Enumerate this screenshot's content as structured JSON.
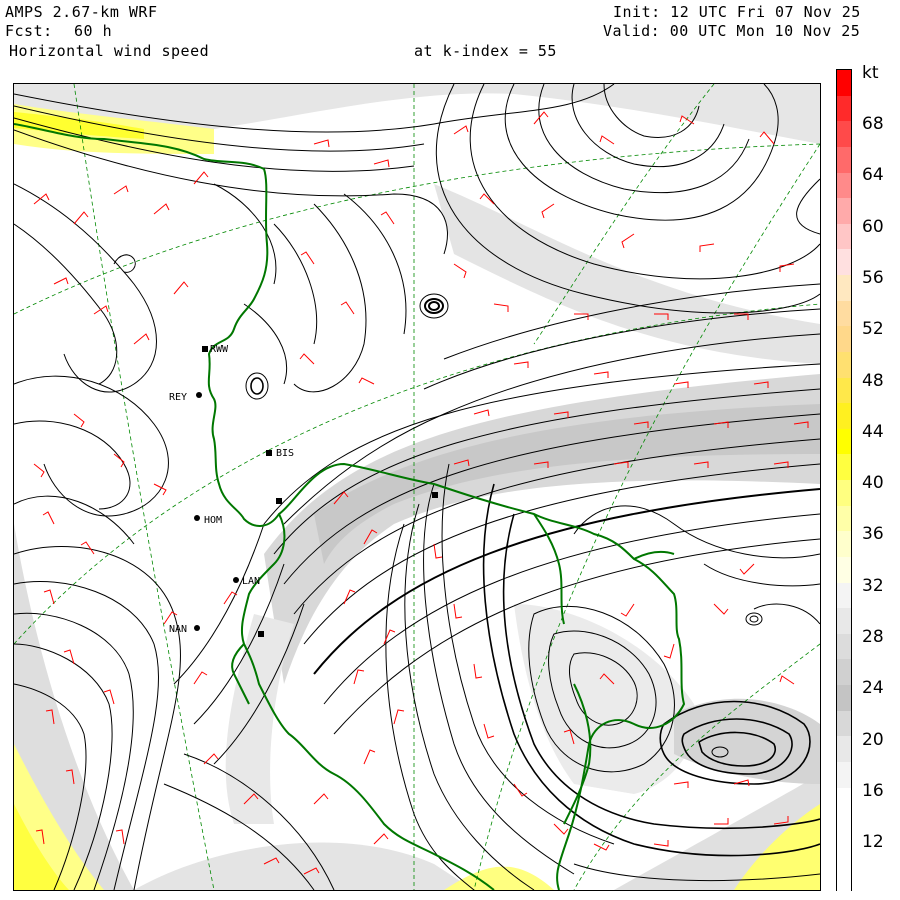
{
  "header": {
    "model": "AMPS 2.67-km WRF",
    "forecast_label": "Fcst:",
    "forecast_hours": "60 h",
    "field": "Horizontal wind speed",
    "init": "Init: 12 UTC Fri 07 Nov 25",
    "valid": "Valid: 00 UTC Mon 10 Nov 25",
    "level": "at k-index = 55"
  },
  "legend": {
    "unit": "kt",
    "labels": [
      "68",
      "64",
      "60",
      "56",
      "52",
      "48",
      "44",
      "40",
      "36",
      "32",
      "28",
      "24",
      "20",
      "16",
      "12"
    ],
    "bins": [
      {
        "color": "#ff0000"
      },
      {
        "color": "#ff2a2a"
      },
      {
        "color": "#ff4a4a"
      },
      {
        "color": "#ff6a6a"
      },
      {
        "color": "#ff8a8a"
      },
      {
        "color": "#ffaaaa"
      },
      {
        "color": "#ffc6c6"
      },
      {
        "color": "#ffe0e0"
      },
      {
        "color": "#ffe8c0"
      },
      {
        "color": "#ffdca0"
      },
      {
        "color": "#ffd88a"
      },
      {
        "color": "#ffe070"
      },
      {
        "color": "#ffe84a"
      },
      {
        "color": "#fff020"
      },
      {
        "color": "#ffff00"
      },
      {
        "color": "#ffff40"
      },
      {
        "color": "#ffff80"
      },
      {
        "color": "#ffffa8"
      },
      {
        "color": "#ffffcc"
      },
      {
        "color": "#ffffe4"
      },
      {
        "color": "#f4f4f4"
      },
      {
        "color": "#e8e8e8"
      },
      {
        "color": "#dcdcdc"
      },
      {
        "color": "#d0d0d0"
      },
      {
        "color": "#c4c4c4"
      },
      {
        "color": "#d8d8d8"
      },
      {
        "color": "#e8e8e8"
      },
      {
        "color": "#f4f4f4"
      },
      {
        "color": "#ffffff"
      },
      {
        "color": "#ffffff"
      },
      {
        "color": "#ffffff"
      },
      {
        "color": "#ffffff"
      }
    ]
  },
  "map": {
    "stations": [
      "RWW",
      "REY",
      "BIS",
      "HOM",
      "LAN",
      "NAN"
    ],
    "coastline_color": "#007700",
    "barb_color": "#ff0000",
    "grid_color": "#008800",
    "streamline_color": "#000000"
  }
}
